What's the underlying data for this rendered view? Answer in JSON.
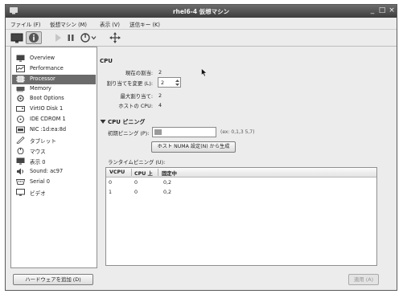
{
  "window": {
    "title": "rhel6-4 仮想マシン",
    "minimize": "_",
    "maximize": "□",
    "close": "×"
  },
  "menu": [
    "ファイル (F)",
    "仮想マシン (M)",
    "表示 (V)",
    "送信キー (K)"
  ],
  "sidebar": {
    "items": [
      {
        "label": "Overview",
        "icon": "overview-icon"
      },
      {
        "label": "Performance",
        "icon": "performance-icon"
      },
      {
        "label": "Processor",
        "icon": "processor-icon",
        "selected": true
      },
      {
        "label": "Memory",
        "icon": "memory-icon"
      },
      {
        "label": "Boot Options",
        "icon": "boot-options-icon"
      },
      {
        "label": "VirtIO Disk 1",
        "icon": "disk-icon"
      },
      {
        "label": "IDE CDROM 1",
        "icon": "cdrom-icon"
      },
      {
        "label": "NIC :1d:ea:8d",
        "icon": "nic-icon"
      },
      {
        "label": "タブレット",
        "icon": "tablet-icon"
      },
      {
        "label": "マウス",
        "icon": "mouse-icon"
      },
      {
        "label": "表示 0",
        "icon": "display-icon"
      },
      {
        "label": "Sound: ac97",
        "icon": "sound-icon"
      },
      {
        "label": "Serial 0",
        "icon": "serial-icon"
      },
      {
        "label": "ビデオ",
        "icon": "video-icon"
      }
    ],
    "add_hardware": "ハードウェアを追加 (D)"
  },
  "cpu": {
    "heading": "CPU",
    "current_label": "現在の割当:",
    "current_value": "2",
    "change_label": "割り当てを変更 (L):",
    "change_value": "2",
    "max_label": "最大割り当て:",
    "max_value": "2",
    "host_label": "ホストの CPU:",
    "host_value": "4"
  },
  "pinning": {
    "heading": "CPU ピニング",
    "default_label": "初期ピニング (P):",
    "default_value": "",
    "example": "(ex: 0,1,3 5,7)",
    "numa_button": "ホスト NUMA 設定(N) から生成",
    "runtime_label": "ランタイムピニング (U):",
    "columns": [
      "VCPU",
      "CPU 上",
      "固定中"
    ],
    "rows": [
      [
        "0",
        "0",
        "0,2"
      ],
      [
        "1",
        "0",
        "0,2"
      ]
    ]
  },
  "apply_button": "適用 (A)",
  "colors": {
    "selection": "#6b6b6b",
    "titlebar": "#4a4a4a",
    "window_bg": "#ececec"
  }
}
